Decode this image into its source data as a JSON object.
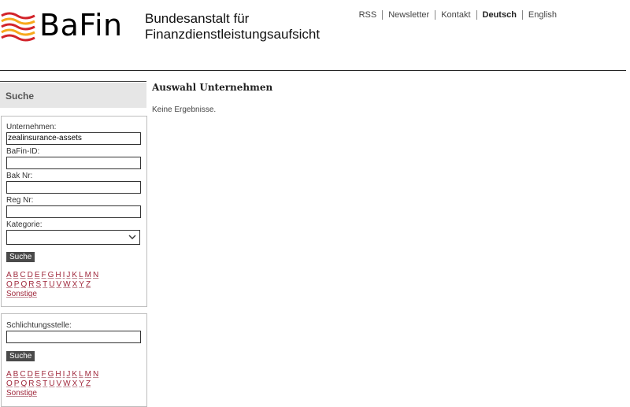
{
  "header": {
    "logo_text": "BaFin",
    "institution_line1": "Bundesanstalt für",
    "institution_line2": "Finanzdienstleistungsaufsicht",
    "nav": [
      "RSS",
      "Newsletter",
      "Kontakt",
      "Deutsch",
      "English"
    ],
    "active_language": "Deutsch"
  },
  "sidebar": {
    "title": "Suche",
    "company_search": {
      "unternehmen_label": "Unternehmen:",
      "unternehmen_value": "zealinsurance-assets",
      "bafin_id_label": "BaFin-ID:",
      "bak_nr_label": "Bak Nr:",
      "reg_nr_label": "Reg Nr:",
      "kategorie_label": "Kategorie:",
      "search_button": "Suche",
      "alphabet_row1": [
        "A",
        "B",
        "C",
        "D",
        "E",
        "F",
        "G",
        "H",
        "I",
        "J",
        "K",
        "L",
        "M",
        "N"
      ],
      "alphabet_row2": [
        "O",
        "P",
        "Q",
        "R",
        "S",
        "T",
        "U",
        "V",
        "W",
        "X",
        "Y",
        "Z"
      ],
      "other_link": "Sonstige"
    },
    "arbitration_search": {
      "label": "Schlichtungsstelle:",
      "search_button": "Suche",
      "alphabet_row1": [
        "A",
        "B",
        "C",
        "D",
        "E",
        "F",
        "G",
        "H",
        "I",
        "J",
        "K",
        "L",
        "M",
        "N"
      ],
      "alphabet_row2": [
        "O",
        "P",
        "Q",
        "R",
        "S",
        "T",
        "U",
        "V",
        "W",
        "X",
        "Y",
        "Z"
      ],
      "other_link": "Sonstige"
    }
  },
  "main": {
    "title": "Auswahl Unternehmen",
    "message": "Keine Ergebnisse."
  },
  "colors": {
    "logo_red": "#d2232a",
    "logo_orange": "#f7a81b",
    "link": "#a0283c",
    "button_bg": "#4a4a4a"
  }
}
